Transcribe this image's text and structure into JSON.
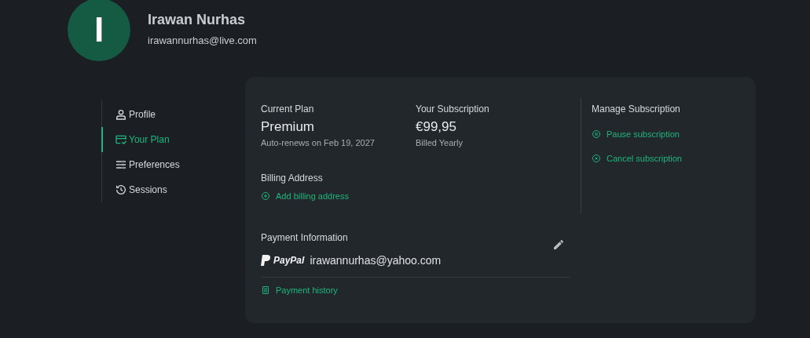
{
  "profile": {
    "initial": "I",
    "name": "Irawan Nurhas",
    "email": "irawannurhas@live.com"
  },
  "nav": [
    {
      "label": "Profile",
      "kind": "person",
      "selected": false
    },
    {
      "label": "Your Plan",
      "kind": "card",
      "selected": true
    },
    {
      "label": "Preferences",
      "kind": "sliders",
      "selected": false
    },
    {
      "label": "Sessions",
      "kind": "history",
      "selected": false
    }
  ],
  "plan": {
    "label": "Current Plan",
    "value": "Premium",
    "note": "Auto-renews on Feb 19, 2027"
  },
  "subscription": {
    "label": "Your Subscription",
    "value": "€99,95",
    "note": "Billed Yearly"
  },
  "billing": {
    "label": "Billing Address",
    "link": "Add billing address"
  },
  "payment": {
    "label": "Payment Information",
    "brand": "PayPal",
    "account": "irawannurhas@yahoo.com",
    "history_link": "Payment history"
  },
  "manage": {
    "label": "Manage Subscription",
    "actions": [
      {
        "label": "Pause subscription",
        "kind": "pause"
      },
      {
        "label": "Cancel subscription",
        "kind": "cancel"
      }
    ]
  }
}
